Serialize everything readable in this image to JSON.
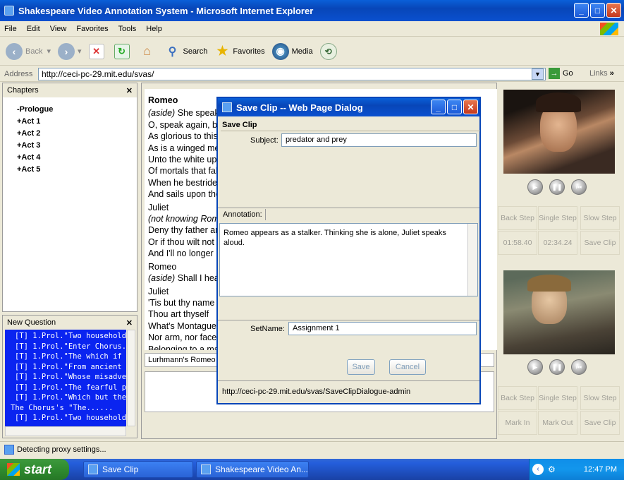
{
  "window": {
    "title": "Shakespeare Video Annotation System - Microsoft Internet Explorer"
  },
  "menu": [
    "File",
    "Edit",
    "View",
    "Favorites",
    "Tools",
    "Help"
  ],
  "toolbar": {
    "back": "Back",
    "search": "Search",
    "favorites": "Favorites",
    "media": "Media"
  },
  "address": {
    "label": "Address",
    "url": "http://ceci-pc-29.mit.edu/svas/",
    "go": "Go",
    "links": "Links"
  },
  "chapters": {
    "title": "Chapters",
    "items": [
      "-Prologue",
      "+Act 1",
      "+Act 2",
      "+Act 3",
      "+Act 4",
      "+Act 5"
    ]
  },
  "new_question": {
    "title": "New Question",
    "items": [
      "[T] 1.Prol.\"Two households",
      "[T] 1.Prol.\"Enter Chorus.....",
      "[T] 1.Prol.\"The which if you...",
      "[T] 1.Prol.\"From ancient g....",
      "[T] 1.Prol.\"Whose misadvent[",
      "[T] 1.Prol.\"The fearful pa....",
      "[T] 1.Prol.\"Which but thei...",
      "The Chorus's \"The......",
      "[T] 1.Prol.\"Two households"
    ]
  },
  "script": {
    "lines": [
      {
        "text": "Romeo",
        "style": "speaker-bold"
      },
      {
        "text": "(aside) She speaks",
        "style": "aside"
      },
      {
        "text": "O, speak again, bright angel",
        "style": "plain"
      },
      {
        "text": "As glorious to this night",
        "style": "plain"
      },
      {
        "text": "As is a winged messenger",
        "style": "plain"
      },
      {
        "text": "Unto the white upturned",
        "style": "plain"
      },
      {
        "text": "Of mortals that fall back",
        "style": "plain"
      },
      {
        "text": "When he bestrides the",
        "style": "plain"
      },
      {
        "text": "And sails upon the bosom",
        "style": "plain"
      },
      {
        "text": "Juliet",
        "style": "speaker"
      },
      {
        "text": "(not knowing Romeo",
        "style": "aside"
      },
      {
        "text": "Deny thy father and",
        "style": "plain"
      },
      {
        "text": "Or if thou wilt not",
        "style": "plain"
      },
      {
        "text": "And I'll no longer be",
        "style": "plain"
      },
      {
        "text": "Romeo",
        "style": "speaker"
      },
      {
        "text": "(aside) Shall I hear",
        "style": "aside"
      },
      {
        "text": "Juliet",
        "style": "speaker"
      },
      {
        "text": "'Tis but thy name",
        "style": "plain"
      },
      {
        "text": "Thou art thyself",
        "style": "plain"
      },
      {
        "text": "What's Montague?",
        "style": "plain"
      },
      {
        "text": "Nor arm, nor face",
        "style": "plain"
      },
      {
        "text": "Belonging to a man",
        "style": "plain"
      }
    ],
    "clip_label": "Lurhmann's Romeo a"
  },
  "video": {
    "top": {
      "back_step": "Back Step",
      "single_step": "Single Step",
      "slow_step": "Slow Step",
      "time_a": "01:58.40",
      "time_b": "02:34.24",
      "save_clip": "Save Clip"
    },
    "bottom": {
      "back_step": "Back Step",
      "single_step": "Single Step",
      "slow_step": "Slow Step",
      "mark_in": "Mark In",
      "mark_out": "Mark Out",
      "save_clip": "Save Clip"
    }
  },
  "dialog": {
    "title": "Save Clip -- Web Page Dialog",
    "section": "Save Clip",
    "subject_label": "Subject:",
    "subject_value": "predator and prey",
    "annotation_tab": "Annotation:",
    "annotation_text": "Romeo appears as a stalker. Thinking she is alone, Juliet speaks aloud.",
    "setname_label": "SetName:",
    "setname_value": "Assignment 1",
    "save": "Save",
    "cancel": "Cancel",
    "status_url": "http://ceci-pc-29.mit.edu/svas/SaveClipDialogue-admin"
  },
  "status": {
    "text": "Detecting proxy settings..."
  },
  "taskbar": {
    "start": "start",
    "task1": "Save Clip",
    "task2": "Shakespeare Video An...",
    "clock": "12:47 PM"
  }
}
